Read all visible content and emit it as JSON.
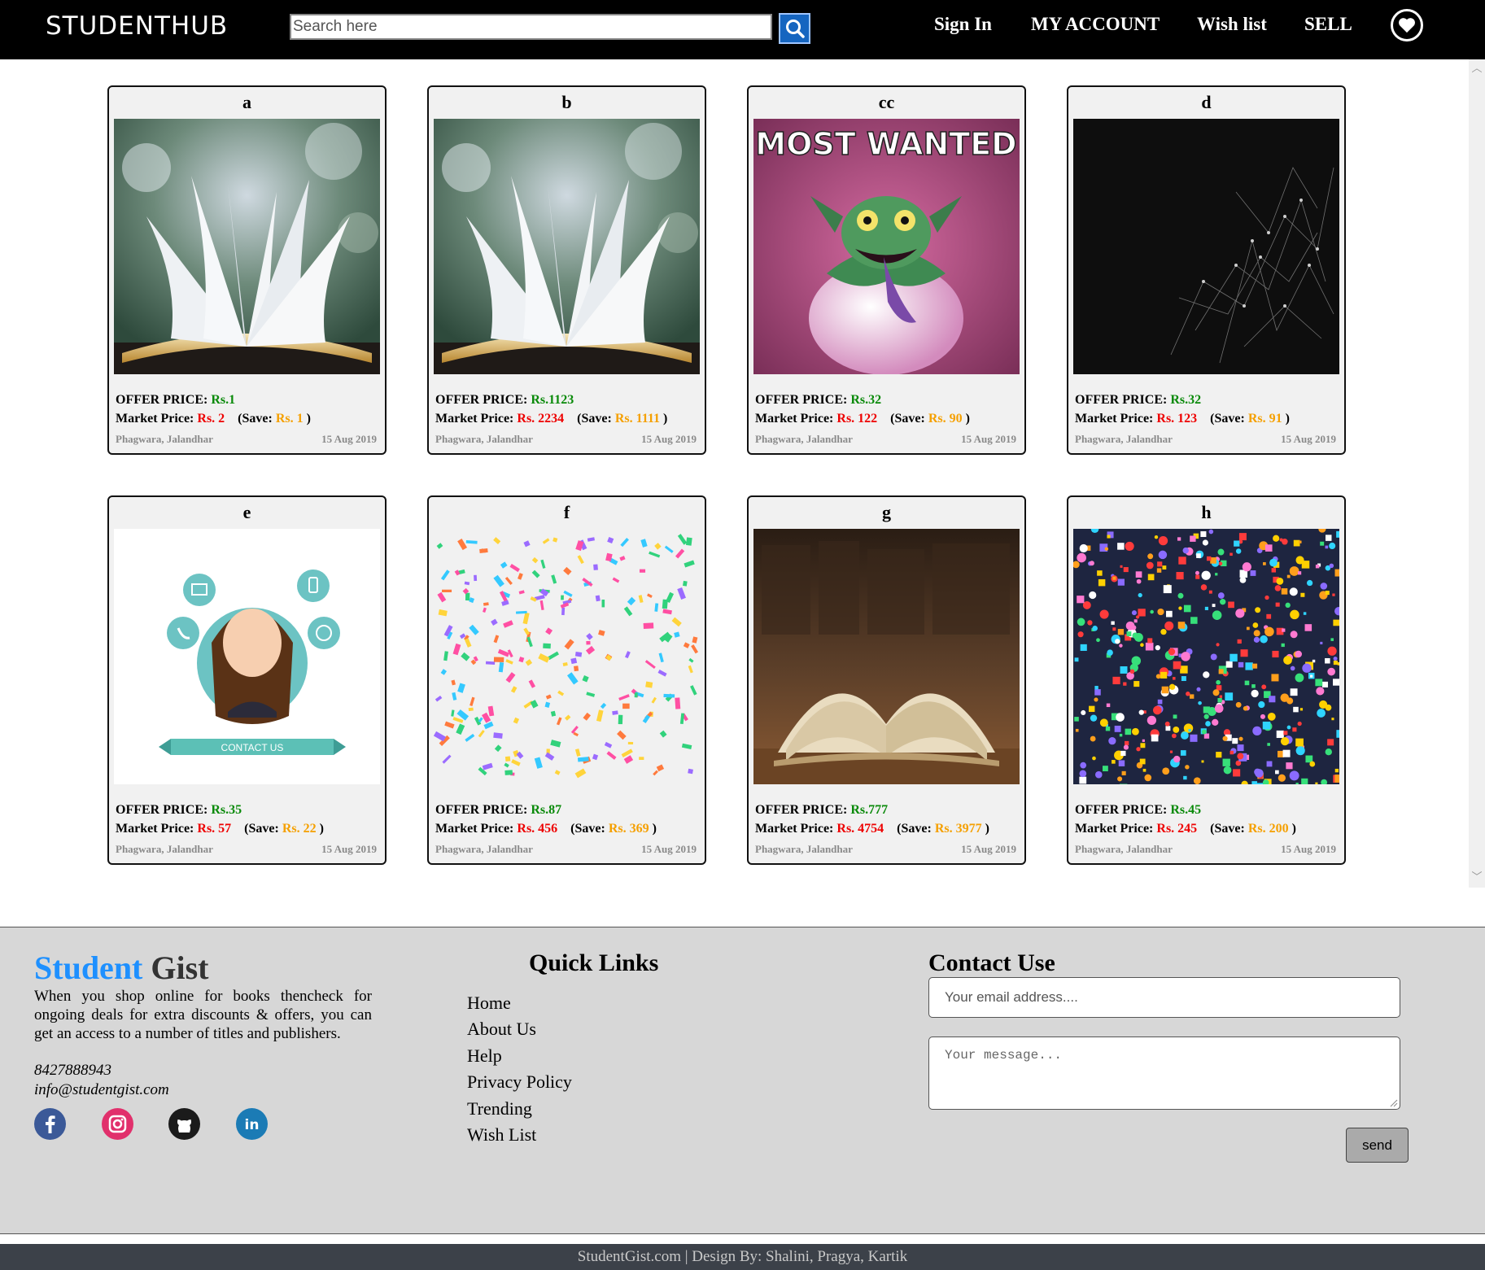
{
  "header": {
    "logo": "STUDENTHUB",
    "search_placeholder": "Search here",
    "nav": {
      "sign_in": "Sign In",
      "my_account": "MY ACCOUNT",
      "wish_list": "Wish list",
      "sell": "SELL"
    }
  },
  "labels": {
    "offer": "OFFER PRICE:",
    "market": "Market Price:",
    "save": "(Save:",
    "close": ")"
  },
  "products": [
    {
      "title": "a",
      "image": "open-book-pages",
      "offer": "Rs.1",
      "market": "Rs. 2",
      "save": "Rs. 1",
      "location": "Phagwara, Jalandhar",
      "date": "15 Aug 2019"
    },
    {
      "title": "b",
      "image": "open-book-pages",
      "offer": "Rs.1123",
      "market": "Rs. 2234",
      "save": "Rs. 1111",
      "location": "Phagwara, Jalandhar",
      "date": "15 Aug 2019"
    },
    {
      "title": "cc",
      "image": "most-wanted-monster",
      "image_text": "MOST WANTED",
      "offer": "Rs.32",
      "market": "Rs. 122",
      "save": "Rs. 90",
      "location": "Phagwara, Jalandhar",
      "date": "15 Aug 2019"
    },
    {
      "title": "d",
      "image": "dark-network",
      "offer": "Rs.32",
      "market": "Rs. 123",
      "save": "Rs. 91",
      "location": "Phagwara, Jalandhar",
      "date": "15 Aug 2019"
    },
    {
      "title": "e",
      "image": "contact-us-illustration",
      "image_text": "CONTACT US",
      "offer": "Rs.35",
      "market": "Rs. 57",
      "save": "Rs. 22",
      "location": "Phagwara, Jalandhar",
      "date": "15 Aug 2019"
    },
    {
      "title": "f",
      "image": "confetti-pattern",
      "offer": "Rs.87",
      "market": "Rs. 456",
      "save": "Rs. 369",
      "location": "Phagwara, Jalandhar",
      "date": "15 Aug 2019"
    },
    {
      "title": "g",
      "image": "open-book-library",
      "offer": "Rs.777",
      "market": "Rs. 4754",
      "save": "Rs. 3977",
      "location": "Phagwara, Jalandhar",
      "date": "15 Aug 2019"
    },
    {
      "title": "h",
      "image": "sticker-pattern",
      "offer": "Rs.45",
      "market": "Rs. 245",
      "save": "Rs. 200",
      "location": "Phagwara, Jalandhar",
      "date": "15 Aug 2019"
    }
  ],
  "footer": {
    "brand_part1": "Student",
    "brand_part2": "Gist",
    "about": "When you shop online for books thencheck for ongoing deals for extra discounts & offers, you can get an access to a number of titles and publishers.",
    "phone": "8427888943",
    "email": "info@studentgist.com",
    "social": [
      "facebook-icon",
      "instagram-icon",
      "github-icon",
      "linkedin-icon"
    ],
    "quick_links_title": "Quick Links",
    "quick_links": [
      "Home",
      "About Us",
      "Help",
      "Privacy Policy",
      "Trending",
      "Wish List"
    ],
    "contact_title": "Contact Use",
    "email_placeholder": "Your email address....",
    "message_placeholder": "Your message...",
    "send_label": "send",
    "copyright": "StudentGist.com | Design By: Shalini, Pragya, Kartik"
  },
  "colors": {
    "offer": "#0a8a0a",
    "market": "#ee0000",
    "save": "#f5a000",
    "brand_blue": "#1e90ff",
    "footer_bg": "#d7d7d7",
    "bottom_bar": "#3c4149"
  }
}
